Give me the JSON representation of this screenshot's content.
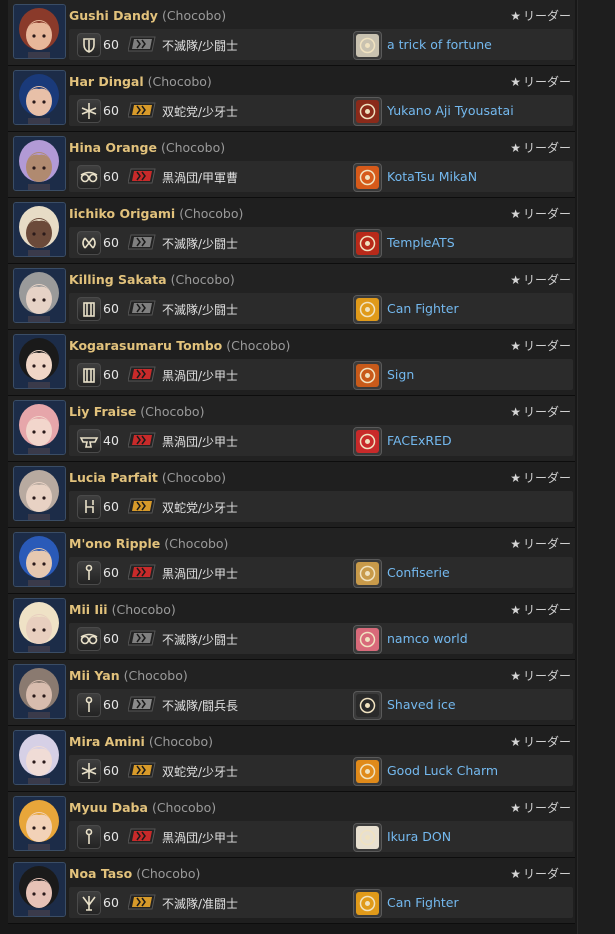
{
  "leader_label": "リーダー",
  "members": [
    {
      "name": "Gushi Dandy",
      "world": "(Chocobo)",
      "level": "60",
      "gc": "不滅隊/少闘士",
      "gc_color": "#7f7f7f",
      "fc": "a trick of fortune",
      "job_icon": "shield-icon",
      "fc_color": "#c9c2b0",
      "hair": "#8a3a2a",
      "skin": "#e7b79a"
    },
    {
      "name": "Har Dingal",
      "world": "(Chocobo)",
      "level": "60",
      "gc": "双蛇党/少牙士",
      "gc_color": "#d79a2a",
      "fc": "Yukano Aji Tyousatai",
      "job_icon": "star-icon",
      "fc_color": "#8a2a1a",
      "hair": "#1a3a7a",
      "skin": "#e8c0a8"
    },
    {
      "name": "Hina Orange",
      "world": "(Chocobo)",
      "level": "60",
      "gc": "黒渦団/甲軍曹",
      "gc_color": "#c82a2a",
      "fc": "KotaTsu MikaN",
      "job_icon": "glasses-icon",
      "fc_color": "#d65a1a",
      "hair": "#b29ad6",
      "skin": "#b08a70"
    },
    {
      "name": "Iichiko Origami",
      "world": "(Chocobo)",
      "level": "60",
      "gc": "不滅隊/少闘士",
      "gc_color": "#7f7f7f",
      "fc": "TempleATS",
      "job_icon": "bracket-icon",
      "fc_color": "#b82a1a",
      "hair": "#e7dcc6",
      "skin": "#6b4a3a"
    },
    {
      "name": "Killing Sakata",
      "world": "(Chocobo)",
      "level": "60",
      "gc": "不滅隊/少闘士",
      "gc_color": "#7f7f7f",
      "fc": "Can Fighter",
      "job_icon": "tower-icon",
      "fc_color": "#e09a1a",
      "hair": "#9a9a9a",
      "skin": "#e6d2c6"
    },
    {
      "name": "Kogarasumaru Tombo",
      "world": "(Chocobo)",
      "level": "60",
      "gc": "黒渦団/少甲士",
      "gc_color": "#c82a2a",
      "fc": "Sign",
      "job_icon": "tower-icon",
      "fc_color": "#c85a1a",
      "hair": "#1a1a1a",
      "skin": "#f0d6c6"
    },
    {
      "name": "Liy Fraise",
      "world": "(Chocobo)",
      "level": "40",
      "gc": "黒渦団/少甲士",
      "gc_color": "#c82a2a",
      "fc": "FACExRED",
      "job_icon": "anvil-icon",
      "fc_color": "#c82a2a",
      "hair": "#e6a6aa",
      "skin": "#f2d6cc"
    },
    {
      "name": "Lucia Parfait",
      "world": "(Chocobo)",
      "level": "60",
      "gc": "双蛇党/少牙士",
      "gc_color": "#d79a2a",
      "fc": "",
      "job_icon": "chair-icon",
      "fc_color": "#222222",
      "hair": "#b8aaa0",
      "skin": "#e8d2c4"
    },
    {
      "name": "M'ono Ripple",
      "world": "(Chocobo)",
      "level": "60",
      "gc": "黒渦団/少甲士",
      "gc_color": "#c82a2a",
      "fc": "Confiserie",
      "job_icon": "wand-icon",
      "fc_color": "#c89a4a",
      "hair": "#2a5ab8",
      "skin": "#e6c8b0"
    },
    {
      "name": "Mii Iii",
      "world": "(Chocobo)",
      "level": "60",
      "gc": "不滅隊/少闘士",
      "gc_color": "#7f7f7f",
      "fc": "namco world",
      "job_icon": "glasses-icon",
      "fc_color": "#d86a7a",
      "hair": "#efe2c6",
      "skin": "#e8cfbf"
    },
    {
      "name": "Mii Yan",
      "world": "(Chocobo)",
      "level": "60",
      "gc": "不滅隊/闘兵長",
      "gc_color": "#8a8a8a",
      "fc": "Shaved ice",
      "job_icon": "wand-icon",
      "fc_color": "#2a2a2a",
      "hair": "#8a7a70",
      "skin": "#d8bcae"
    },
    {
      "name": "Mira Amini",
      "world": "(Chocobo)",
      "level": "60",
      "gc": "双蛇党/少牙士",
      "gc_color": "#d79a2a",
      "fc": "Good Luck Charm",
      "job_icon": "star-icon",
      "fc_color": "#e08a1a",
      "hair": "#d6d0e6",
      "skin": "#f0dcd6"
    },
    {
      "name": "Myuu Daba",
      "world": "(Chocobo)",
      "level": "60",
      "gc": "黒渦団/少甲士",
      "gc_color": "#c82a2a",
      "fc": "Ikura DON",
      "job_icon": "wand-icon",
      "fc_color": "#e8e0d0",
      "hair": "#e8a63a",
      "skin": "#f2d2b8"
    },
    {
      "name": "Noa Taso",
      "world": "(Chocobo)",
      "level": "60",
      "gc": "不滅隊/准闘士",
      "gc_color": "#d79a2a",
      "fc": "Can Fighter",
      "job_icon": "trident-icon",
      "fc_color": "#e09a1a",
      "hair": "#1a1a1a",
      "skin": "#e6c2b6"
    }
  ]
}
